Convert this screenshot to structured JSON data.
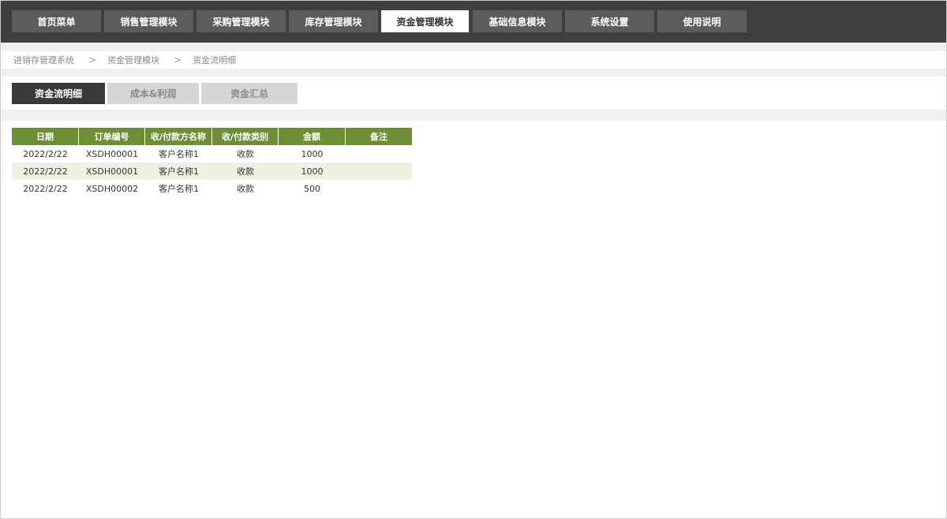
{
  "nav": {
    "items": [
      {
        "label": "首页菜单"
      },
      {
        "label": "销售管理模块"
      },
      {
        "label": "采购管理模块"
      },
      {
        "label": "库存管理模块"
      },
      {
        "label": "资金管理模块"
      },
      {
        "label": "基础信息模块"
      },
      {
        "label": "系统设置"
      },
      {
        "label": "使用说明"
      }
    ],
    "active_index": 4
  },
  "breadcrumb": {
    "items": [
      "进销存管理系统",
      "资金管理模块",
      "资金流明细"
    ],
    "separator": ">"
  },
  "tabs": {
    "items": [
      {
        "label": "资金流明细"
      },
      {
        "label": "成本&利润"
      },
      {
        "label": "资金汇总"
      }
    ],
    "active_index": 0
  },
  "table": {
    "columns": [
      "日期",
      "订单编号",
      "收/付款方名称",
      "收/付款类别",
      "金额",
      "备注"
    ],
    "rows": [
      [
        "2022/2/22",
        "XSDH00001",
        "客户名称1",
        "收款",
        "1000",
        ""
      ],
      [
        "2022/2/22",
        "XSDH00001",
        "客户名称1",
        "收款",
        "1000",
        ""
      ],
      [
        "2022/2/22",
        "XSDH00002",
        "客户名称1",
        "收款",
        "500",
        ""
      ]
    ]
  },
  "colors": {
    "nav_bg": "#3f3f3f",
    "nav_button": "#5c5c5c",
    "table_header": "#6d8f33",
    "row_alt": "#eef2e2",
    "tab_active": "#3a3a3a",
    "tab_inactive": "#d6d6d6"
  }
}
